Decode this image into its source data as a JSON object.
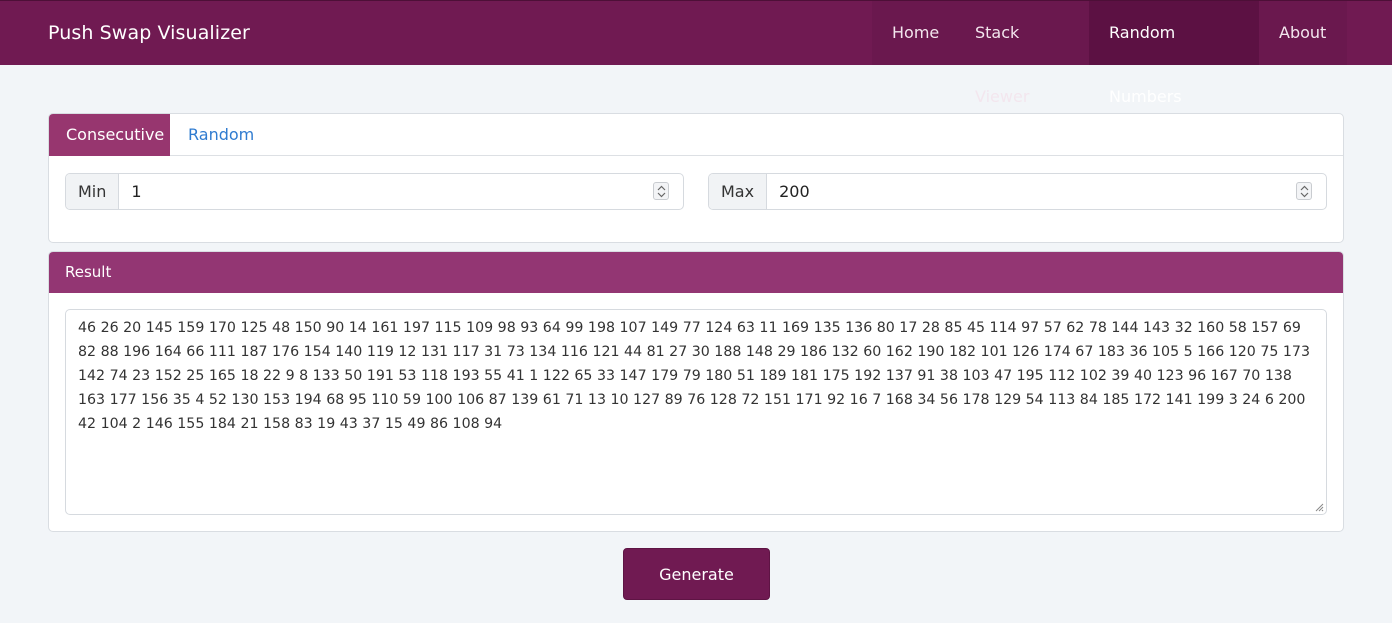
{
  "navbar": {
    "brand": "Push Swap Visualizer",
    "items": [
      {
        "label": "Home"
      },
      {
        "label": "Stack Viewer"
      },
      {
        "label": "Random Numbers"
      },
      {
        "label": "About"
      }
    ],
    "active": "Random Numbers"
  },
  "range_card": {
    "tabs": [
      {
        "label": "Consecutive",
        "active": true
      },
      {
        "label": "Random",
        "active": false
      }
    ],
    "min": {
      "label": "Min",
      "value": "1"
    },
    "max": {
      "label": "Max",
      "value": "200"
    }
  },
  "result_card": {
    "header": "Result",
    "text": "46 26 20 145 159 170 125 48 150 90 14 161 197 115 109 98 93 64 99 198 107 149 77 124 63 11 169 135 136 80 17 28 85 45 114 97 57 62 78 144 143 32 160 58 157 69 82 88 196 164 66 111 187 176 154 140 119 12 131 117 31 73 134 116 121 44 81 27 30 188 148 29 186 132 60 162 190 182 101 126 174 67 183 36 105 5 166 120 75 173 142 74 23 152 25 165 18 22 9 8 133 50 191 53 118 193 55 41 1 122 65 33 147 179 79 180 51 189 181 175 192 137 91 38 103 47 195 112 102 39 40 123 96 167 70 138 163 177 156 35 4 52 130 153 194 68 95 110 59 100 106 87 139 61 71 13 10 127 89 76 128 72 151 171 92 16 7 168 34 56 178 129 54 113 84 185 172 141 199 3 24 6 200 42 104 2 146 155 184 21 158 83 19 43 37 15 49 86 108 94"
  },
  "generate": {
    "label": "Generate"
  },
  "colors": {
    "navbar": "#701a52",
    "active_tab": "#97366f",
    "result_header": "#933673",
    "link": "#2f7bd0"
  },
  "icons": {
    "spinner": "number-spinner-icon",
    "resize": "resize-handle-icon"
  }
}
